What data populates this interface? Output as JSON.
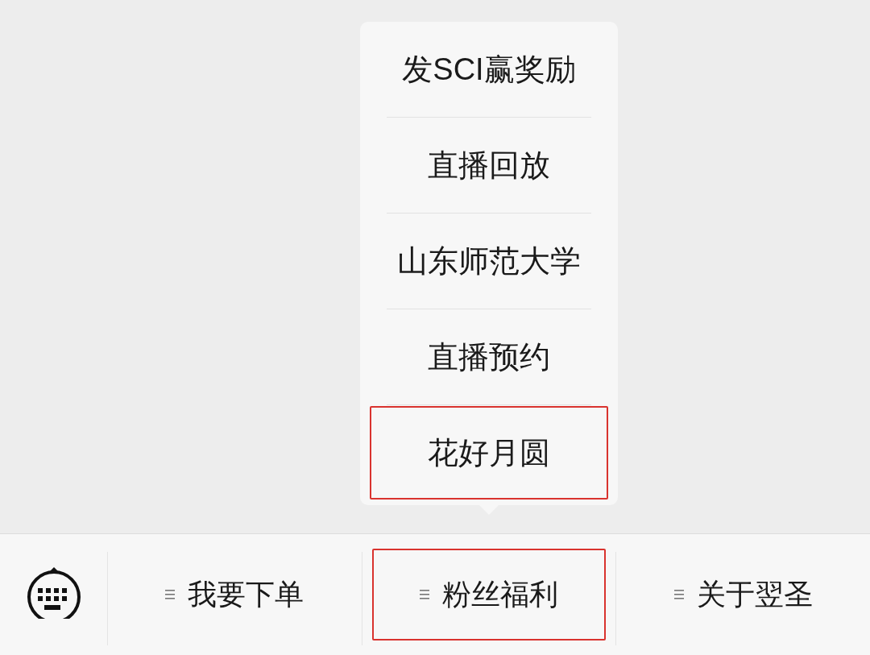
{
  "menu": {
    "items": [
      {
        "label": "发SCI赢奖励",
        "highlighted": false
      },
      {
        "label": "直播回放",
        "highlighted": false
      },
      {
        "label": "山东师范大学",
        "highlighted": false
      },
      {
        "label": "直播预约",
        "highlighted": false
      },
      {
        "label": "花好月圆",
        "highlighted": true
      }
    ]
  },
  "bottom_bar": {
    "tabs": [
      {
        "label": "我要下单",
        "highlighted": false
      },
      {
        "label": "粉丝福利",
        "highlighted": true
      },
      {
        "label": "关于翌圣",
        "highlighted": false
      }
    ]
  }
}
